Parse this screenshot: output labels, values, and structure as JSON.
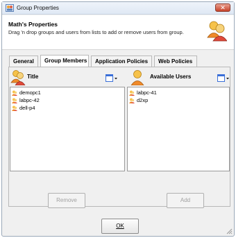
{
  "window": {
    "title": "Group Properties"
  },
  "header": {
    "title": "Math's Properties",
    "description": "Drag 'n drop groups and users from lists to add or remove users from group."
  },
  "tabs": [
    {
      "label": "General",
      "active": false
    },
    {
      "label": "Group Members",
      "active": true
    },
    {
      "label": "Application Policies",
      "active": false
    },
    {
      "label": "Web Policies",
      "active": false
    }
  ],
  "left_pane": {
    "column_label": "Title",
    "items": [
      "demopc1",
      "labpc-42",
      "dell-p4"
    ],
    "button_label": "Remove"
  },
  "right_pane": {
    "column_label": "Available Users",
    "items": [
      "labpc-41",
      "d2xp"
    ],
    "button_label": "Add"
  },
  "footer": {
    "ok_label": "OK"
  },
  "colors": {
    "accent_orange": "#f0a030",
    "close_red": "#c7432a",
    "view_blue": "#3a6fd8"
  }
}
